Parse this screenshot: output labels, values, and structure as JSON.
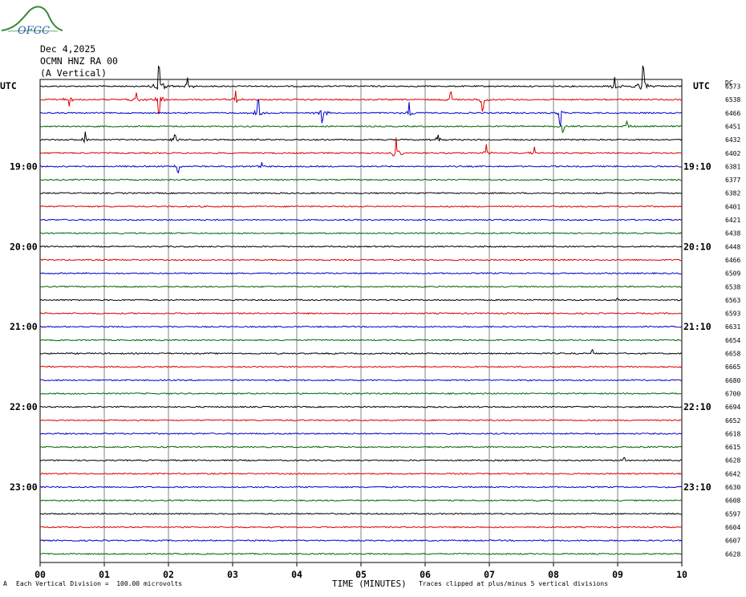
{
  "logo": {
    "text": "OFGC",
    "colors": {
      "swoosh": "#3a8a3a",
      "text": "#1f5fb0"
    }
  },
  "header": {
    "date": "Dec 4,2025",
    "station": "OCMN HNZ RA 00",
    "component": "(A Vertical)"
  },
  "left_label": "UTC",
  "right_label": "UTC",
  "dc_label": "DC",
  "footer": {
    "scale": "Each Vertical Division =  100.00 microvolts",
    "clip": "Traces clipped at plus/minus 5 vertical divisions",
    "mark": "A"
  },
  "chart_data": {
    "type": "line",
    "title": "",
    "xlabel": "TIME (MINUTES)",
    "xlim": [
      0,
      10
    ],
    "x_ticks": [
      "00",
      "01",
      "02",
      "03",
      "04",
      "05",
      "06",
      "07",
      "08",
      "09",
      "10"
    ],
    "grid": true,
    "trace_colors": [
      "#000000",
      "#dd0000",
      "#0000cc",
      "#006600"
    ],
    "left_time_labels": [
      {
        "row": 6,
        "label": "19:00"
      },
      {
        "row": 12,
        "label": "20:00"
      },
      {
        "row": 18,
        "label": "21:00"
      },
      {
        "row": 24,
        "label": "22:00"
      },
      {
        "row": 30,
        "label": "23:00"
      }
    ],
    "right_time_labels": [
      {
        "row": 6,
        "label": "19:10"
      },
      {
        "row": 12,
        "label": "20:10"
      },
      {
        "row": 18,
        "label": "21:10"
      },
      {
        "row": 24,
        "label": "22:10"
      },
      {
        "row": 30,
        "label": "23:10"
      }
    ],
    "dc_offsets": [
      "6573",
      "6538",
      "6466",
      "6451",
      "6432",
      "6402",
      "6381",
      "6377",
      "6382",
      "6401",
      "6421",
      "6438",
      "6448",
      "6466",
      "6509",
      "6538",
      "6563",
      "6593",
      "6631",
      "6654",
      "6658",
      "6665",
      "6680",
      "6700",
      "6694",
      "6652",
      "6618",
      "6615",
      "6628",
      "6642",
      "6630",
      "6608",
      "6597",
      "6604",
      "6607",
      "6628"
    ],
    "trace_count": 36,
    "events": [
      {
        "row": 0,
        "minute": 1.85,
        "amplitude": 5,
        "polarity": 1
      },
      {
        "row": 0,
        "minute": 2.3,
        "amplitude": 2,
        "polarity": 1
      },
      {
        "row": 0,
        "minute": 9.4,
        "amplitude": 5,
        "polarity": 1
      },
      {
        "row": 0,
        "minute": 8.95,
        "amplitude": 2,
        "polarity": 1
      },
      {
        "row": 1,
        "minute": 0.45,
        "amplitude": 2,
        "polarity": -1
      },
      {
        "row": 1,
        "minute": 1.5,
        "amplitude": 1.5,
        "polarity": 1
      },
      {
        "row": 1,
        "minute": 1.85,
        "amplitude": 3,
        "polarity": -1
      },
      {
        "row": 1,
        "minute": 3.05,
        "amplitude": 2,
        "polarity": 1
      },
      {
        "row": 1,
        "minute": 6.9,
        "amplitude": 3,
        "polarity": -1
      },
      {
        "row": 1,
        "minute": 6.4,
        "amplitude": 1.5,
        "polarity": 1
      },
      {
        "row": 2,
        "minute": 3.4,
        "amplitude": 2.5,
        "polarity": 1
      },
      {
        "row": 2,
        "minute": 4.4,
        "amplitude": 2,
        "polarity": -1
      },
      {
        "row": 2,
        "minute": 5.75,
        "amplitude": 2,
        "polarity": 1
      },
      {
        "row": 2,
        "minute": 8.1,
        "amplitude": 2.5,
        "polarity": -1
      },
      {
        "row": 3,
        "minute": 8.15,
        "amplitude": 1.5,
        "polarity": -1
      },
      {
        "row": 3,
        "minute": 9.15,
        "amplitude": 1,
        "polarity": 1
      },
      {
        "row": 4,
        "minute": 0.7,
        "amplitude": 1.5,
        "polarity": 1
      },
      {
        "row": 4,
        "minute": 2.1,
        "amplitude": 1,
        "polarity": 1
      },
      {
        "row": 4,
        "minute": 6.2,
        "amplitude": 1.5,
        "polarity": 1
      },
      {
        "row": 5,
        "minute": 5.55,
        "amplitude": 3,
        "polarity": 1
      },
      {
        "row": 5,
        "minute": 6.95,
        "amplitude": 1.5,
        "polarity": 1
      },
      {
        "row": 5,
        "minute": 7.7,
        "amplitude": 1.5,
        "polarity": 1
      },
      {
        "row": 6,
        "minute": 2.15,
        "amplitude": 1.2,
        "polarity": -1
      },
      {
        "row": 6,
        "minute": 3.45,
        "amplitude": 1.2,
        "polarity": 1
      },
      {
        "row": 20,
        "minute": 8.6,
        "amplitude": 0.8,
        "polarity": 1
      },
      {
        "row": 28,
        "minute": 9.1,
        "amplitude": 0.8,
        "polarity": 1
      },
      {
        "row": 16,
        "minute": 9.0,
        "amplitude": 0.6,
        "polarity": 1
      }
    ]
  }
}
